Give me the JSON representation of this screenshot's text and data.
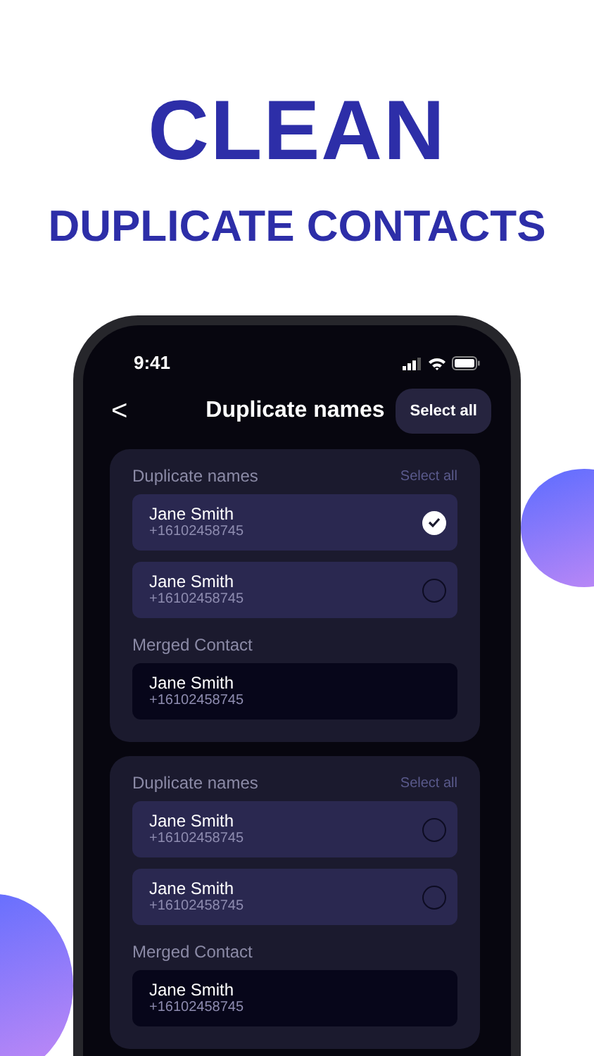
{
  "headline": {
    "title": "CLEAN",
    "subtitle": "DUPLICATE CONTACTS"
  },
  "status_bar": {
    "time": "9:41"
  },
  "header": {
    "back": "<",
    "title": "Duplicate names",
    "action": "Select all"
  },
  "groups": [
    {
      "label": "Duplicate names",
      "select_all": {
        "label": "Select all",
        "disabled": true
      },
      "contacts": [
        {
          "name": "Jane Smith",
          "phone": "+16102458745",
          "selected": true
        },
        {
          "name": "Jane Smith",
          "phone": "+16102458745",
          "selected": false
        }
      ],
      "merged_label": "Merged Contact",
      "merged": {
        "name": "Jane Smith",
        "phone": "+16102458745"
      }
    },
    {
      "label": "Duplicate names",
      "select_all": {
        "label": "Select all",
        "disabled": true
      },
      "contacts": [
        {
          "name": "Jane Smith",
          "phone": "+16102458745",
          "selected": false
        },
        {
          "name": "Jane Smith",
          "phone": "+16102458745",
          "selected": false
        }
      ],
      "merged_label": "Merged Contact",
      "merged": {
        "name": "Jane Smith",
        "phone": "+16102458745"
      }
    }
  ]
}
